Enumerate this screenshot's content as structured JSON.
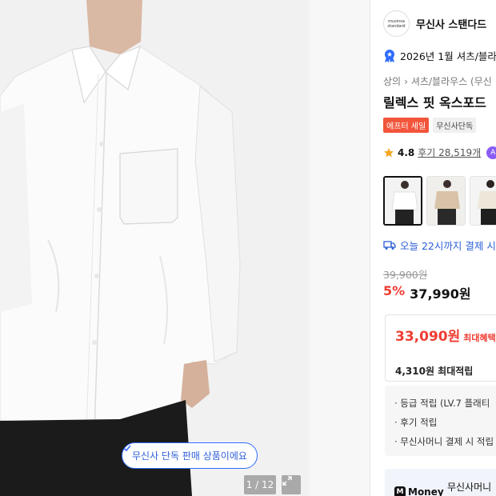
{
  "gallery": {
    "exclusive_pill": "무신사 단독 판매 상품이에요",
    "counter": "1 / 12"
  },
  "brand": {
    "logo_line1": "musinsa",
    "logo_line2": "standard",
    "name": "무신사 스탠다드"
  },
  "award": {
    "text": "2026년 1월 셔츠/블라"
  },
  "breadcrumb": {
    "level1": "상의",
    "sep": "›",
    "level2": "셔츠/블라우스 (무신"
  },
  "product": {
    "title": "릴렉스 핏 옥스포드",
    "badge_sale": "에프터 세일",
    "badge_exclusive": "무신사단독"
  },
  "rating": {
    "score": "4.8",
    "reviews": "후기 28,519개",
    "more_badge": "A"
  },
  "shipping": {
    "text": "오늘 22시까지 결제 시"
  },
  "price": {
    "original": "39,900원",
    "discount_rate": "5%",
    "sale_price": "37,990원"
  },
  "benefit": {
    "max_price": "33,090원",
    "max_label": "최대혜택",
    "max_points": "4,310원 최대적립"
  },
  "points_list": [
    "· 등급 적립 (LV.7 플래티",
    "· 후기 적립",
    "· 무신사머니 결제 시 적립"
  ],
  "money": {
    "logo": "Money",
    "text": "무신사머니"
  },
  "colors": {
    "accent_blue": "#2f6bff",
    "sale_red": "#ef3d33",
    "badge_orange": "#f2553b"
  }
}
